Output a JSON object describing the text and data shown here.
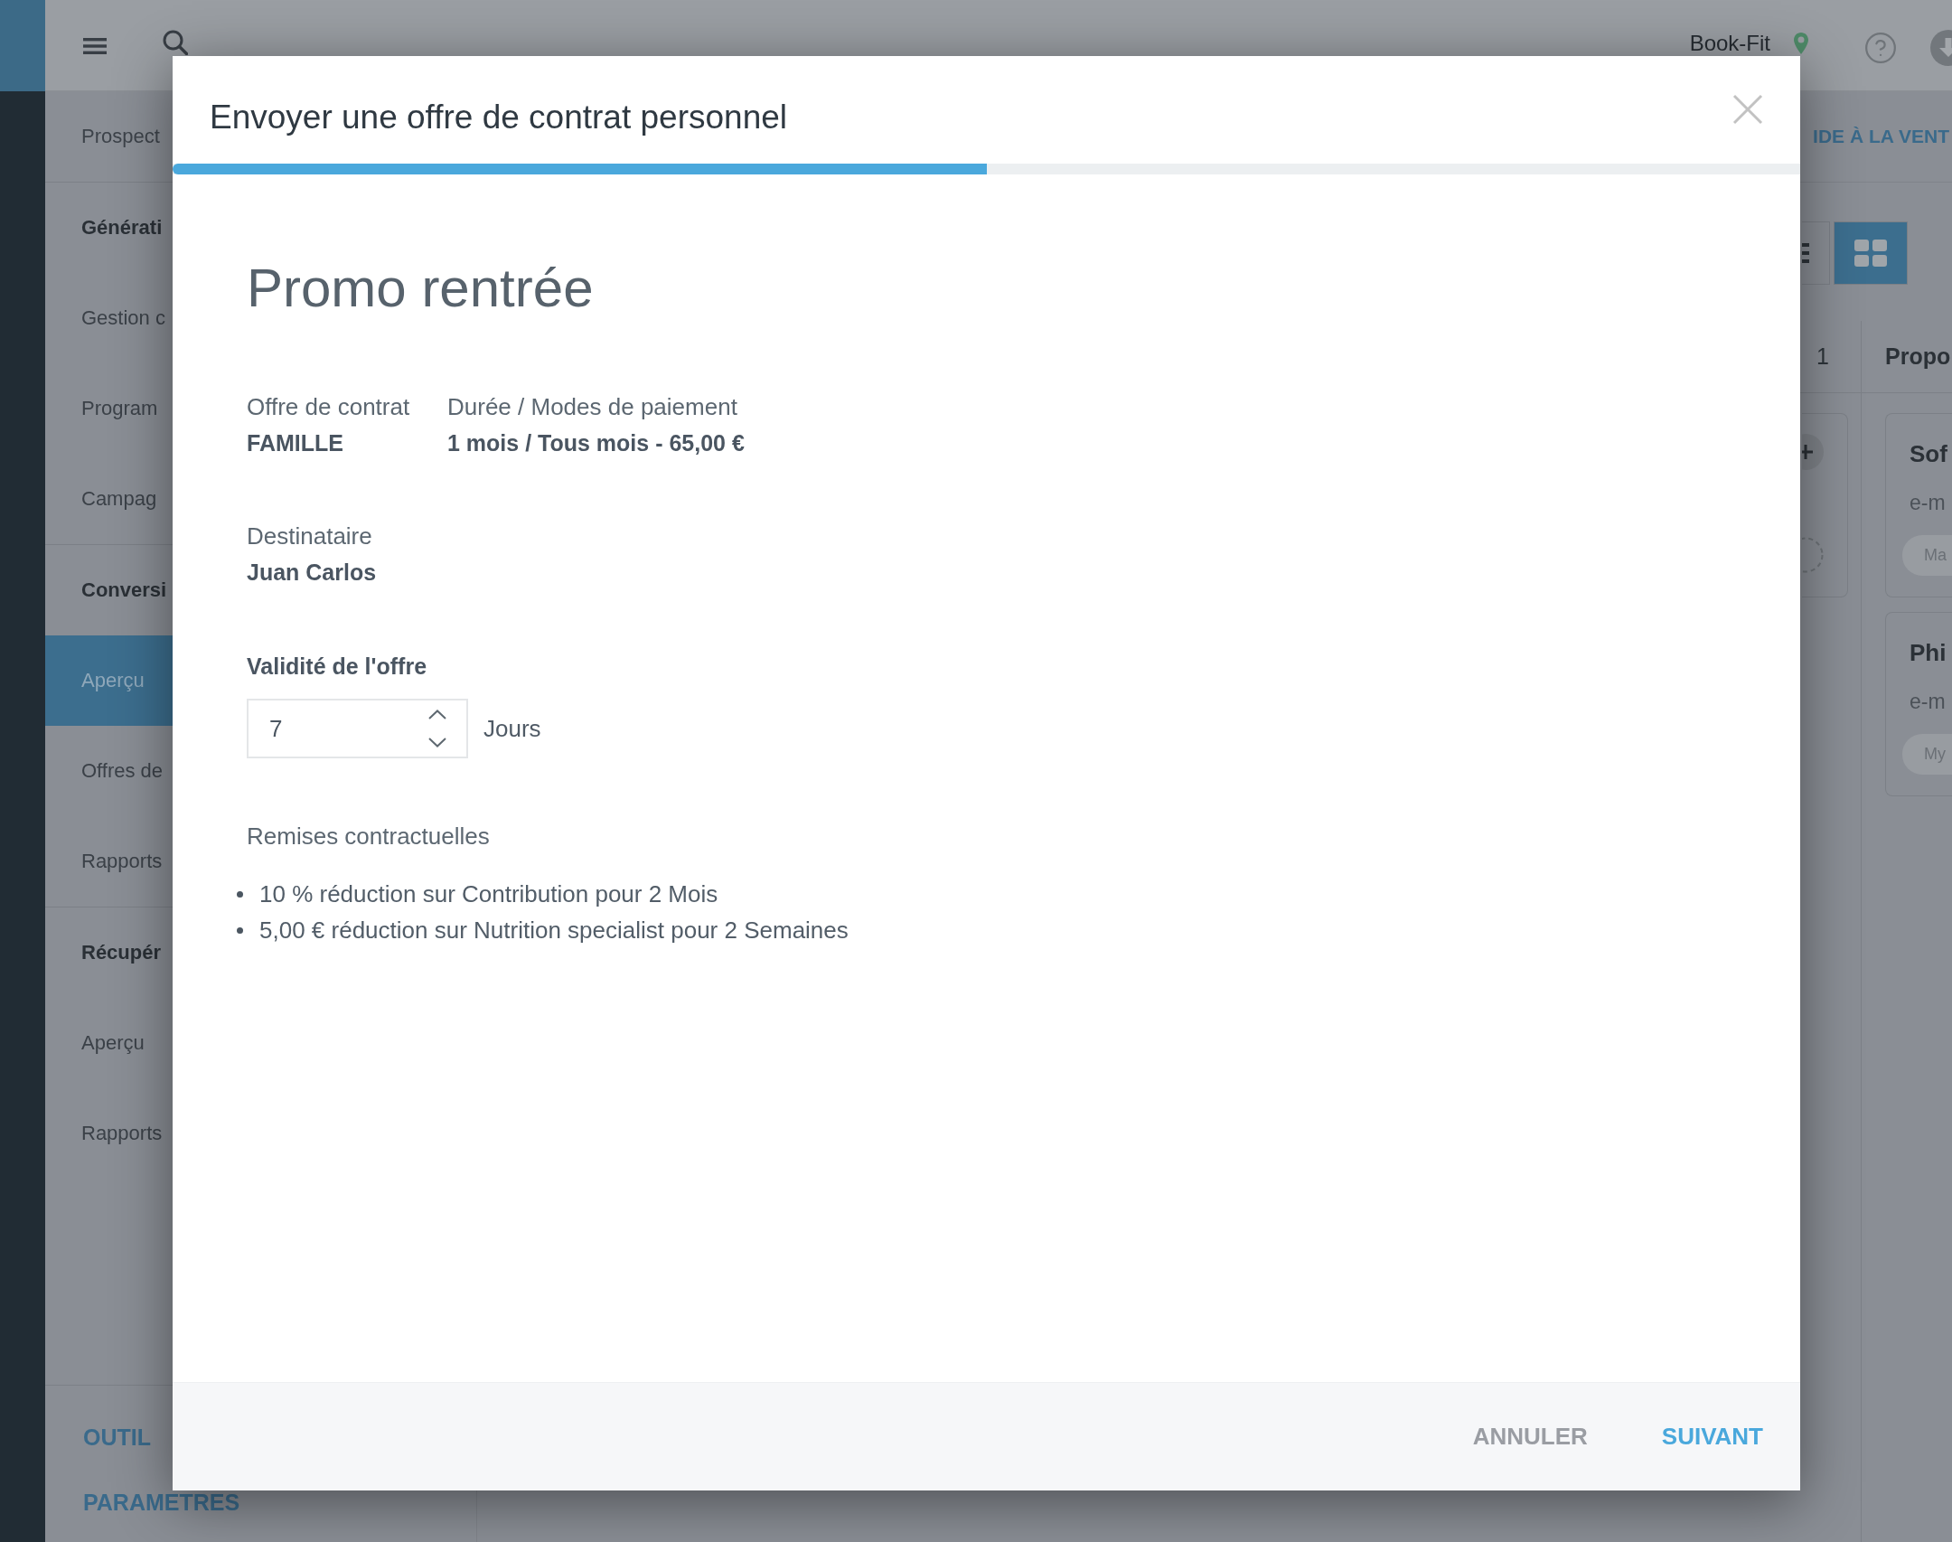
{
  "top_bar": {
    "location": "Book-Fit"
  },
  "sidebar": {
    "title": "Prospect",
    "sections": [
      {
        "title": "Générati",
        "items": [
          {
            "label": "Gestion c",
            "selected": false
          },
          {
            "label": "Program",
            "selected": false
          },
          {
            "label": "Campag",
            "selected": false
          }
        ]
      },
      {
        "title": "Conversi",
        "items": [
          {
            "label": "Aperçu",
            "selected": true
          },
          {
            "label": "Offres de",
            "selected": false
          },
          {
            "label": "Rapports",
            "selected": false
          }
        ]
      },
      {
        "title": "Récupér",
        "items": [
          {
            "label": "Aperçu",
            "selected": false
          },
          {
            "label": "Rapports",
            "selected": false
          }
        ]
      }
    ],
    "footer_links": [
      "OUTIL",
      "PARAMETRES"
    ]
  },
  "main": {
    "header_link": "IDE À LA VENT",
    "view_buttons": [
      {
        "kind": "list",
        "selected": false
      },
      {
        "kind": "grid",
        "selected": true
      }
    ],
    "board": {
      "columns": [
        {
          "count": "1",
          "cards": [
            {
              "kind": "empty"
            }
          ]
        },
        {
          "title": "Propo",
          "cards": [
            {
              "kind": "contact",
              "name": "Sof",
              "line_2": "e-m",
              "tag": "Ma"
            },
            {
              "kind": "contact",
              "name": "Phi",
              "line_2": "e-m",
              "tag": "My"
            }
          ]
        }
      ]
    }
  },
  "dialog": {
    "title": "Envoyer une offre de contrat personnel",
    "progress": {
      "level": 0.5
    },
    "heading": "Promo rentrée",
    "details": [
      {
        "label": "Offre de contrat",
        "value": "FAMILLE"
      },
      {
        "label": "Durée / Modes de paiement",
        "value": "1 mois / Tous mois - 65,00 €"
      }
    ],
    "recipient": {
      "label": "Destinataire",
      "value": "Juan Carlos"
    },
    "validity": {
      "label": "Validité de l'offre",
      "value": "7",
      "unit": "Jours"
    },
    "discounts": {
      "title": "Remises contractuelles",
      "items": [
        "10 % réduction sur Contribution pour 2 Mois",
        "5,00 € réduction sur Nutrition specialist pour 2 Semaines"
      ]
    },
    "buttons": [
      {
        "label": "ANNULER",
        "kind": "secondary"
      },
      {
        "label": "SUIVANT",
        "kind": "primary"
      }
    ]
  }
}
